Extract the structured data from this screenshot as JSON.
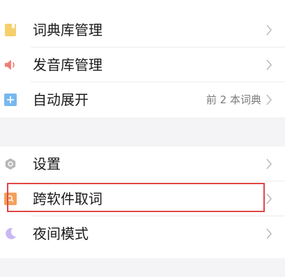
{
  "section1": {
    "items": [
      {
        "label": "词典库管理",
        "icon": "dictionary-book-icon",
        "icon_color": "#f6cf6d"
      },
      {
        "label": "发音库管理",
        "icon": "speaker-icon",
        "icon_color": "#f07d73"
      },
      {
        "label": "自动展开",
        "icon": "plus-square-icon",
        "icon_color": "#78b8ef",
        "value": "前 2 本词典"
      }
    ]
  },
  "section2": {
    "items": [
      {
        "label": "设置",
        "icon": "settings-hexagon-icon",
        "icon_color": "#b8b8b8"
      },
      {
        "label": "跨软件取词",
        "icon": "search-square-icon",
        "icon_color": "#f3a15a",
        "highlighted": true
      },
      {
        "label": "夜间模式",
        "icon": "moon-icon",
        "icon_color": "#c9b8f2"
      }
    ]
  },
  "colors": {
    "highlight_border": "#e04646",
    "chevron": "#bcbcbc",
    "background": "#f4f4f6"
  }
}
